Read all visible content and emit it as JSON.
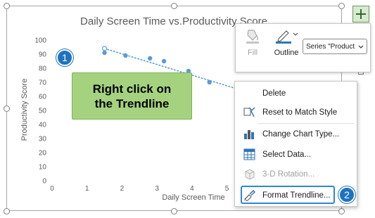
{
  "chart_data": {
    "type": "scatter",
    "title": "Daily Screen Time vs.Productivity Score",
    "xlabel": "Daily Screen Time",
    "ylabel": "Productivity Score",
    "xlim": [
      0,
      7
    ],
    "ylim": [
      0,
      100
    ],
    "x_ticks": [
      "0",
      "1",
      "2",
      "3",
      "4",
      "5"
    ],
    "y_ticks": [
      "0",
      "10",
      "20",
      "30",
      "40",
      "50",
      "60",
      "70",
      "80",
      "90",
      "100"
    ],
    "grid": false,
    "series": [
      {
        "x": [
          1.5,
          1.5,
          2.1,
          2.8,
          3.2,
          3.9,
          4.5
        ],
        "y": [
          94,
          91,
          89,
          87,
          85,
          78,
          70
        ]
      }
    ],
    "trendline": {
      "type": "linear",
      "style": "dotted",
      "selected": true,
      "x_range": [
        1.5,
        5.2
      ],
      "y_at_start": 94,
      "y_at_end": 66
    },
    "colors": {
      "marker": "#5b9bd5",
      "trendline": "#5b9bd5",
      "axis_text": "#595959"
    }
  },
  "annotation": {
    "text": "Right click on\nthe Trendline"
  },
  "badges": {
    "step1": "1",
    "step2": "2"
  },
  "side_buttons": {
    "chart_elements_icon": "plus-icon"
  },
  "mini_toolbar": {
    "fill_label": "Fill",
    "outline_label": "Outline",
    "series_select": "Series \"Product",
    "fill_icon": "paint-bucket-icon",
    "outline_icon": "pen-outline-icon"
  },
  "context_menu": {
    "items": [
      {
        "label": "Delete",
        "icon": "none",
        "enabled": true
      },
      {
        "label": "Reset to Match Style",
        "icon": "reset-style-icon",
        "enabled": true
      },
      {
        "label": "Change Chart Type...",
        "icon": "bar-chart-icon",
        "enabled": true
      },
      {
        "label": "Select Data...",
        "icon": "table-grid-icon",
        "enabled": true
      },
      {
        "label": "3-D Rotation...",
        "icon": "rotation-cube-icon",
        "enabled": false
      },
      {
        "label": "Format Trendline...",
        "icon": "format-brush-icon",
        "enabled": true
      }
    ]
  }
}
